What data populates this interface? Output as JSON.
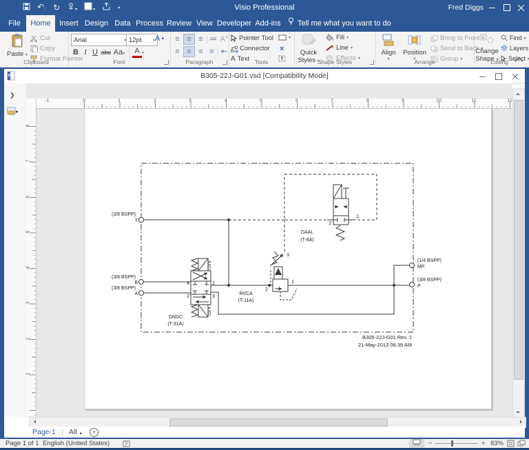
{
  "titlebar": {
    "app_title": "Visio Professional",
    "user": "Fred Diggs"
  },
  "tabs": {
    "file": "File",
    "items": [
      "Home",
      "Insert",
      "Design",
      "Data",
      "Process",
      "Review",
      "View",
      "Developer",
      "Add-ins"
    ],
    "tell_me": "Tell me what you want to do"
  },
  "ribbon": {
    "clipboard": {
      "label": "Clipboard",
      "paste": "Paste",
      "cut": "Cut",
      "copy": "Copy",
      "format_painter": "Format Painter"
    },
    "font": {
      "label": "Font",
      "family": "Arial",
      "size": "12pt.",
      "bold": "B",
      "italic": "I",
      "underline": "U",
      "strike": "abc",
      "case": "Aa",
      "grow": "A",
      "shrink": "A",
      "color": "A"
    },
    "paragraph": {
      "label": "Paragraph"
    },
    "tools": {
      "label": "Tools",
      "pointer": "Pointer Tool",
      "connector": "Connector",
      "text": "Text"
    },
    "shape_styles": {
      "label": "Shape Styles",
      "quick1": "Quick",
      "quick2": "Styles",
      "fill": "Fill",
      "line": "Line",
      "effects": "Effects"
    },
    "arrange": {
      "label": "Arrange",
      "align": "Align",
      "position": "Position",
      "bring": "Bring to Front",
      "send": "Send to Back",
      "group": "Group"
    },
    "editing": {
      "label": "Editing",
      "change1": "Change",
      "change2": "Shape",
      "find": "Find",
      "layers": "Layers",
      "select": "Select"
    }
  },
  "document": {
    "title": "B305-22J-G01.vsd  [Compatibility Mode]"
  },
  "rulers": {
    "h": [
      "-1",
      "0",
      "1",
      "2",
      "3",
      "4",
      "5",
      "6",
      "7",
      "8",
      "9",
      "10",
      "11",
      "12"
    ],
    "v": [
      "8",
      "7",
      "6",
      "5",
      "4",
      "3",
      "2",
      "1"
    ]
  },
  "schematic": {
    "ports": {
      "t": {
        "spec": "(3/8 BSPP)",
        "name": "T"
      },
      "b": {
        "spec": "(3/8 BSPP)",
        "name": "B"
      },
      "a": {
        "spec": "(3/8 BSPP)",
        "name": "A"
      },
      "mp": {
        "spec": "(1/4 BSPP)",
        "name": "MP"
      },
      "p": {
        "spec": "(3/8 BSPP)",
        "name": "P"
      }
    },
    "daal": {
      "name": "DAAL",
      "model": "(T-8A)",
      "p1": "1",
      "p2": "2"
    },
    "rvca": {
      "name": "RVCA",
      "model": "(T-11A)",
      "p1": "1",
      "p2": "2",
      "p3": "3"
    },
    "dndc": {
      "name": "DNDC",
      "model": "(T-31A)",
      "p1": "1",
      "p2": "2",
      "p3": "3",
      "p4": "4",
      "coil_a": "Coil A",
      "coil_b": "Coil B"
    },
    "title_block": {
      "line1": "B305-22J-G01 Rev. 1",
      "line2": "21-May-2013 06:39 AM"
    }
  },
  "pagebar": {
    "page": "Page-1",
    "all": "All"
  },
  "statusbar": {
    "page": "Page 1 of 1",
    "language": "English (United States)",
    "zoom": "83%"
  },
  "colors": {
    "accent": "#2d5796",
    "ribbon_bg": "#f3f3f3",
    "canvas": "#e8e8e8",
    "schematic_stroke": "#3a3a3a"
  }
}
